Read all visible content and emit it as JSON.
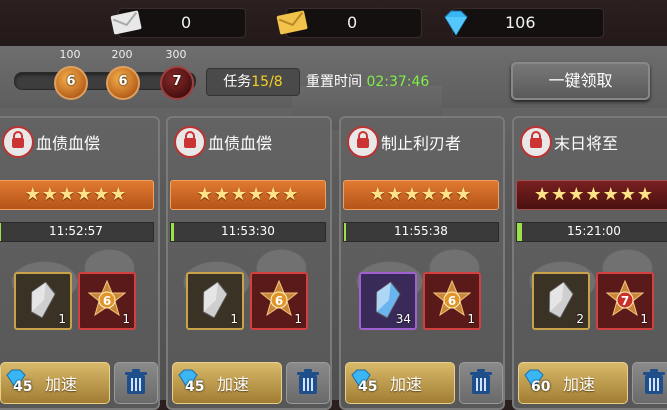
{
  "currencies": {
    "mail": {
      "icon": "envelope-icon",
      "value": "0"
    },
    "gold_mail": {
      "icon": "gold-envelope-icon",
      "value": "0"
    },
    "diamond": {
      "icon": "diamond-icon",
      "value": "106"
    }
  },
  "milestones": [
    {
      "label": "100",
      "badge": "6"
    },
    {
      "label": "200",
      "badge": "6"
    },
    {
      "label": "300",
      "badge": "7"
    }
  ],
  "mission": {
    "prefix": "任务",
    "count": "15/8"
  },
  "reset": {
    "label": "重置时间",
    "time": "02:37:46"
  },
  "claim_all_label": "一键领取",
  "cards": [
    {
      "title": "血债血偿",
      "stars": "★★★★★★",
      "time": "11:52:57",
      "progress": 0.0,
      "items": [
        {
          "type": "crystal",
          "count": "1"
        },
        {
          "type": "badge",
          "badge": "6",
          "count": "1"
        }
      ],
      "cost": "45",
      "speed_label": "加速"
    },
    {
      "title": "血债血偿",
      "stars": "★★★★★★",
      "time": "11:53:30",
      "progress": 0.02,
      "items": [
        {
          "type": "crystal",
          "count": "1"
        },
        {
          "type": "badge",
          "badge": "6",
          "count": "1"
        }
      ],
      "cost": "45",
      "speed_label": "加速"
    },
    {
      "title": "制止利刃者",
      "stars": "★★★★★★",
      "time": "11:55:38",
      "progress": 0.0,
      "items": [
        {
          "type": "blue-crystal",
          "count": "34"
        },
        {
          "type": "badge",
          "badge": "6",
          "count": "1"
        }
      ],
      "cost": "45",
      "speed_label": "加速"
    },
    {
      "title": "末日将至",
      "stars": "★★★★★★★",
      "time": "15:21:00",
      "progress": 0.03,
      "items": [
        {
          "type": "crystal",
          "count": "2"
        },
        {
          "type": "badge",
          "badge": "7",
          "count": "1"
        }
      ],
      "cost": "60",
      "speed_label": "加速"
    }
  ]
}
